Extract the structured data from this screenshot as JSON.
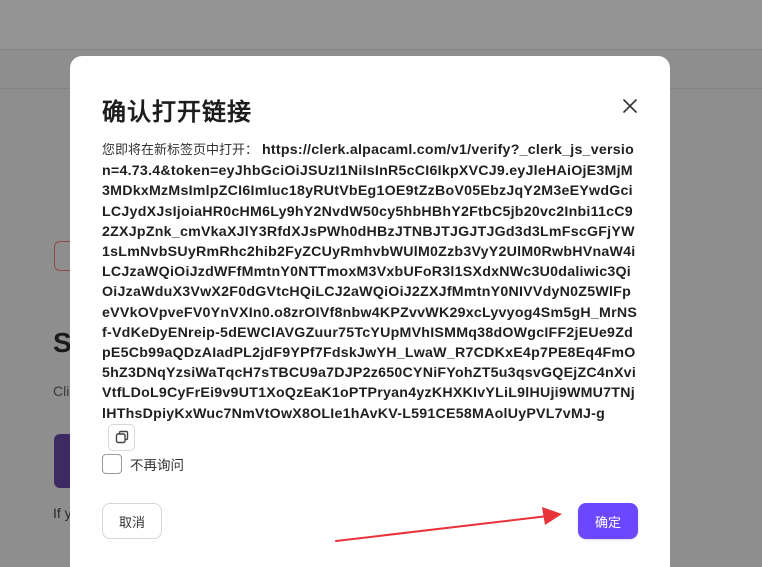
{
  "background": {
    "heading_initial": "S",
    "text_line1": "Cli",
    "text_line2": "If y"
  },
  "dialog": {
    "title": "确认打开链接",
    "lead": "您即将在新标签页中打开：",
    "url": "https://clerk.alpacaml.com/v1/verify?_clerk_js_version=4.73.4&token=eyJhbGciOiJSUzI1NiIsInR5cCI6IkpXVCJ9.eyJleHAiOjE3MjM3MDkxMzMsImlpZCI6ImIuc18yRUtVbEg1OE9tZzBoV05EbzJqY2M3eEYwdGciLCJydXJsIjoiaHR0cHM6Ly9hY2NvdW50cy5hbHBhY2FtbC5jb20vc2Inbi11cC92ZXJpZnk_cmVkaXJlY3RfdXJsPWh0dHBzJTNBJTJGJTJGd3d3LmFscGFjYW1sLmNvbSUyRmRhc2hib2FyZCUyRmhvbWUlM0Zzb3VyY2UlM0RwbHVnaW4iLCJzaWQiOiJzdWFfMmtnY0NTTmoxM3VxbUFoR3l1SXdxNWc3U0daliwic3QiOiJzaWduX3VwX2F0dGVtcHQiLCJ2aWQiOiJ2ZXJfMmtnY0NIVVdyN0Z5WlFpeVVkOVpveFV0YnVXIn0.o8zrOIVf8nbw4KPZvvWK29xcLyvyog4Sm5gH_MrNSf-VdKeDyENreip-5dEWClAVGZuur75TcYUpMVhISMMq38dOWgcIFF2jEUe9ZdpE5Cb99aQDzAIadPL2jdF9YPf7FdskJwYH_LwaW_R7CDKxE4p7PE8Eq4FmO5hZ3DNqYzsiWaTqcH7sTBCU9a7DJP2z650CYNiFYohZT5u3qsvGQEjZC4nXviVtfLDoL9CyFrEi9v9UT1XoQzEaK1oPTPryan4yzKHXKIvYLiL9lHUji9WMU7TNjlHThsDpiyKxWuc7NmVtOwX8OLIe1hAvKV-L591CE58MAolUyPVL7vMJ-g",
    "checkbox_label": "不再询问",
    "cancel_label": "取消",
    "confirm_label": "确定",
    "icons": {
      "close": "close-icon",
      "copy": "copy-icon"
    },
    "colors": {
      "primary": "#6c47ff",
      "annotation_arrow": "#e8333a"
    }
  }
}
